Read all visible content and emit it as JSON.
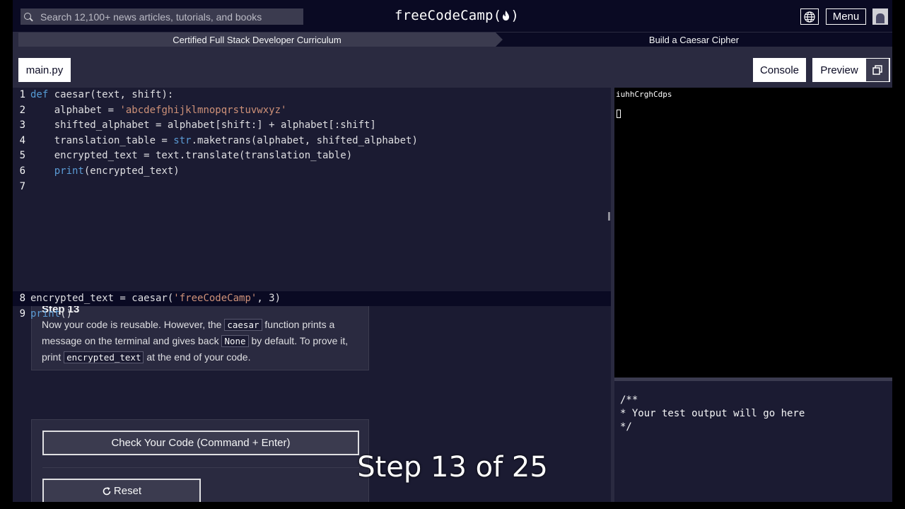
{
  "header": {
    "search_placeholder": "Search 12,100+ news articles, tutorials, and books",
    "logo_text": "freeCodeCamp(",
    "logo_flame": "🔥",
    "logo_close": ")",
    "menu_label": "Menu"
  },
  "breadcrumb": {
    "curriculum": "Certified Full Stack Developer Curriculum",
    "project": "Build a Caesar Cipher"
  },
  "editor": {
    "file_tab": "main.py",
    "lines_top": [
      {
        "n": "1",
        "parts": [
          [
            "kw",
            "def"
          ],
          [
            "txt",
            " caesar(text, shift):"
          ]
        ]
      },
      {
        "n": "2",
        "parts": [
          [
            "txt",
            "    alphabet = "
          ],
          [
            "str",
            "'abcdefghijklmnopqrstuvwxyz'"
          ]
        ]
      },
      {
        "n": "3",
        "parts": [
          [
            "txt",
            "    shifted_alphabet = alphabet[shift:] + alphabet[:shift]"
          ]
        ]
      },
      {
        "n": "4",
        "parts": [
          [
            "txt",
            "    translation_table = "
          ],
          [
            "fn",
            "str"
          ],
          [
            "txt",
            ".maketrans(alphabet, shifted_alphabet)"
          ]
        ]
      },
      {
        "n": "5",
        "parts": [
          [
            "txt",
            "    encrypted_text = text.translate(translation_table)"
          ]
        ]
      },
      {
        "n": "6",
        "parts": [
          [
            "txt",
            "    "
          ],
          [
            "fn",
            "print"
          ],
          [
            "txt",
            "(encrypted_text)"
          ]
        ]
      },
      {
        "n": "7",
        "parts": [
          [
            "txt",
            ""
          ]
        ]
      }
    ],
    "lines_bottom": [
      {
        "n": "8",
        "parts": [
          [
            "txt",
            "encrypted_text = caesar("
          ],
          [
            "str",
            "'freeCodeCamp'"
          ],
          [
            "txt",
            ", 3)"
          ]
        ]
      },
      {
        "n": "9",
        "parts": [
          [
            "fn",
            "print"
          ],
          [
            "txt",
            "()"
          ]
        ]
      }
    ]
  },
  "step": {
    "title": "Step 13",
    "text_1": "Now your code is reusable. However, the ",
    "code_1": "caesar",
    "text_2": " function prints a message on the terminal and gives back ",
    "code_2": "None",
    "text_3": " by default. To prove it, print ",
    "code_3": "encrypted_text",
    "text_4": " at the end of your code."
  },
  "actions": {
    "check_label": "Check Your Code (Command + Enter)",
    "reset_label": "Reset"
  },
  "preview": {
    "console_label": "Console",
    "preview_label": "Preview",
    "console_output": "iuhhCrghCdps"
  },
  "tests": {
    "line_1": "/**",
    "line_2": "* Your test output will go here",
    "line_3": "*/"
  },
  "caption": "Step 13 of 25"
}
